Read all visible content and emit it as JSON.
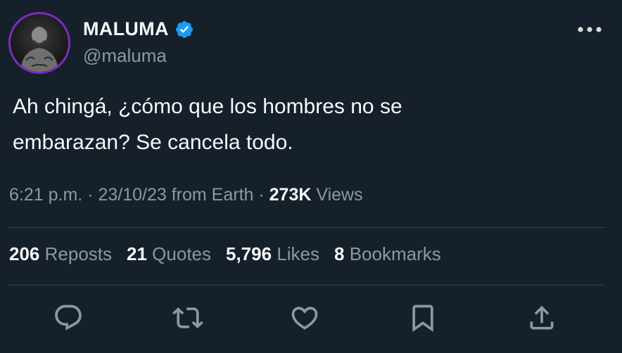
{
  "author": {
    "display_name": "MALUMA",
    "handle": "@maluma",
    "verified_icon": "verified-badge-icon",
    "verified_color": "#1d9bf0",
    "avatar_ring_color": "#7b2cbf"
  },
  "tweet": {
    "text_lines": [
      "Ah chingá, ¿cómo que los hombres no se",
      "embarazan? Se cancela todo."
    ]
  },
  "meta": {
    "time": "6:21 p.m.",
    "separator": " · ",
    "date": "23/10/23",
    "source": "from Earth",
    "views_count": "273K",
    "views_label": "Views"
  },
  "stats": {
    "reposts": {
      "count": "206",
      "label": "Reposts"
    },
    "quotes": {
      "count": "21",
      "label": "Quotes"
    },
    "likes": {
      "count": "5,796",
      "label": "Likes"
    },
    "bookmarks": {
      "count": "8",
      "label": "Bookmarks"
    }
  },
  "actions": [
    "reply-icon",
    "repost-icon",
    "like-icon",
    "bookmark-icon",
    "share-icon"
  ],
  "colors": {
    "background": "#15202b",
    "primary_text": "#f7f9f9",
    "secondary_text": "#8b98a5",
    "divider": "#38444d"
  }
}
